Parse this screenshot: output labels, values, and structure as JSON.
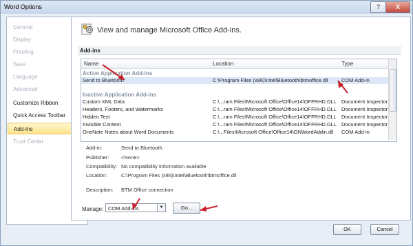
{
  "window": {
    "title": "Word Options",
    "help_label": "?",
    "close_label": "X"
  },
  "nav": [
    {
      "label": "General",
      "state": "disabled"
    },
    {
      "label": "Display",
      "state": "disabled"
    },
    {
      "label": "Proofing",
      "state": "disabled"
    },
    {
      "label": "Save",
      "state": "disabled"
    },
    {
      "label": "Language",
      "state": "disabled"
    },
    {
      "label": "Advanced",
      "state": "disabled"
    },
    {
      "label": "Customize Ribbon",
      "state": "normal"
    },
    {
      "label": "Quick Access Toolbar",
      "state": "normal"
    },
    {
      "label": "Add-Ins",
      "state": "selected"
    },
    {
      "label": "Trust Center",
      "state": "disabled"
    }
  ],
  "header": {
    "icon": "gears-icon",
    "text": "View and manage Microsoft Office Add-ins."
  },
  "section_title": "Add-ins",
  "list": {
    "columns": {
      "name": "Name",
      "location": "Location",
      "type": "Type"
    },
    "groups": [
      {
        "title": "Active Application Add-ins",
        "rows": [
          {
            "name": "Send to Bluetooth",
            "location": "C:\\Program Files (x86)\\Intel\\Bluetooth\\btmoffice.dll",
            "type": "COM Add-in",
            "selected": true
          }
        ]
      },
      {
        "title": "Inactive Application Add-ins",
        "rows": [
          {
            "name": "Custom XML Data",
            "location": "C:\\...ram Files\\Microsoft Office\\Office14\\OFFRHD.DLL",
            "type": "Document Inspector"
          },
          {
            "name": "Headers, Footers, and Watermarks",
            "location": "C:\\...ram Files\\Microsoft Office\\Office14\\OFFRHD.DLL",
            "type": "Document Inspector"
          },
          {
            "name": "Hidden Text",
            "location": "C:\\...ram Files\\Microsoft Office\\Office14\\OFFRHD.DLL",
            "type": "Document Inspector"
          },
          {
            "name": "Invisible Content",
            "location": "C:\\...ram Files\\Microsoft Office\\Office14\\OFFRHD.DLL",
            "type": "Document Inspector"
          },
          {
            "name": "OneNote Notes about Word Documents",
            "location": "C:\\...Files\\Microsoft Office\\Office14\\ONWordAddin.dll",
            "type": "COM Add-in"
          }
        ]
      }
    ]
  },
  "details": {
    "addin_label": "Add-in:",
    "addin_value": "Send to Bluetooth",
    "publisher_label": "Publisher:",
    "publisher_value": "<None>",
    "compat_label": "Compatibility:",
    "compat_value": "No compatibility information available",
    "location_label": "Location:",
    "location_value": "C:\\Program Files (x86)\\Intel\\Bluetooth\\btmoffice.dll",
    "description_label": "Description:",
    "description_value": "BTM Office connection"
  },
  "manage": {
    "label": "Manage:",
    "selected": "COM Add-ins",
    "go_label": "Go..."
  },
  "footer": {
    "ok_label": "OK",
    "cancel_label": "Cancel"
  },
  "colors": {
    "selection": "#ffe38a",
    "arrow": "#c8202a"
  }
}
